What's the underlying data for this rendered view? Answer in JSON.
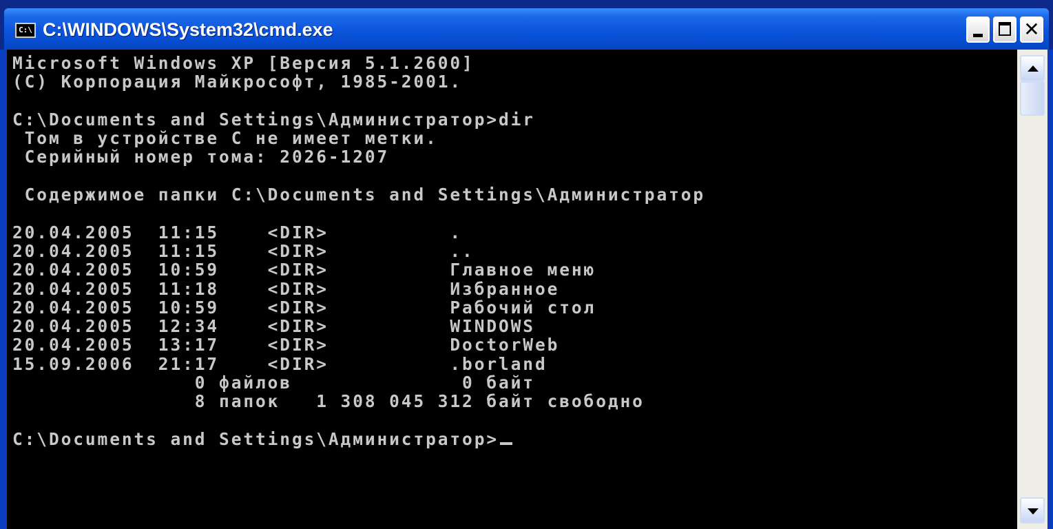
{
  "window": {
    "title": "C:\\WINDOWS\\System32\\cmd.exe",
    "icon": "cmd-icon",
    "icon_text": "C:\\",
    "controls": {
      "minimize": "minimize-icon",
      "maximize": "maximize-icon",
      "close": "close-icon",
      "close_glyph": "✕"
    }
  },
  "console": {
    "lines": [
      "Microsoft Windows XP [Версия 5.1.2600]",
      "(С) Корпорация Майкрософт, 1985-2001.",
      "",
      "C:\\Documents and Settings\\Администратор>dir",
      " Том в устройстве C не имеет метки.",
      " Серийный номер тома: 2026-1207",
      "",
      " Содержимое папки C:\\Documents and Settings\\Администратор",
      "",
      "20.04.2005  11:15    <DIR>          .",
      "20.04.2005  11:15    <DIR>          ..",
      "20.04.2005  10:59    <DIR>          Главное меню",
      "20.04.2005  11:18    <DIR>          Избранное",
      "20.04.2005  10:59    <DIR>          Рабочий стол",
      "20.04.2005  12:34    <DIR>          WINDOWS",
      "20.04.2005  13:17    <DIR>          DoctorWeb",
      "15.09.2006  21:17    <DIR>          .borland",
      "               0 файлов              0 байт",
      "               8 папок   1 308 045 312 байт свободно",
      "",
      "C:\\Documents and Settings\\Администратор>"
    ]
  },
  "colors": {
    "console_bg": "#000000",
    "console_text": "#c8c8c8",
    "titlebar": "#0a55dc"
  }
}
